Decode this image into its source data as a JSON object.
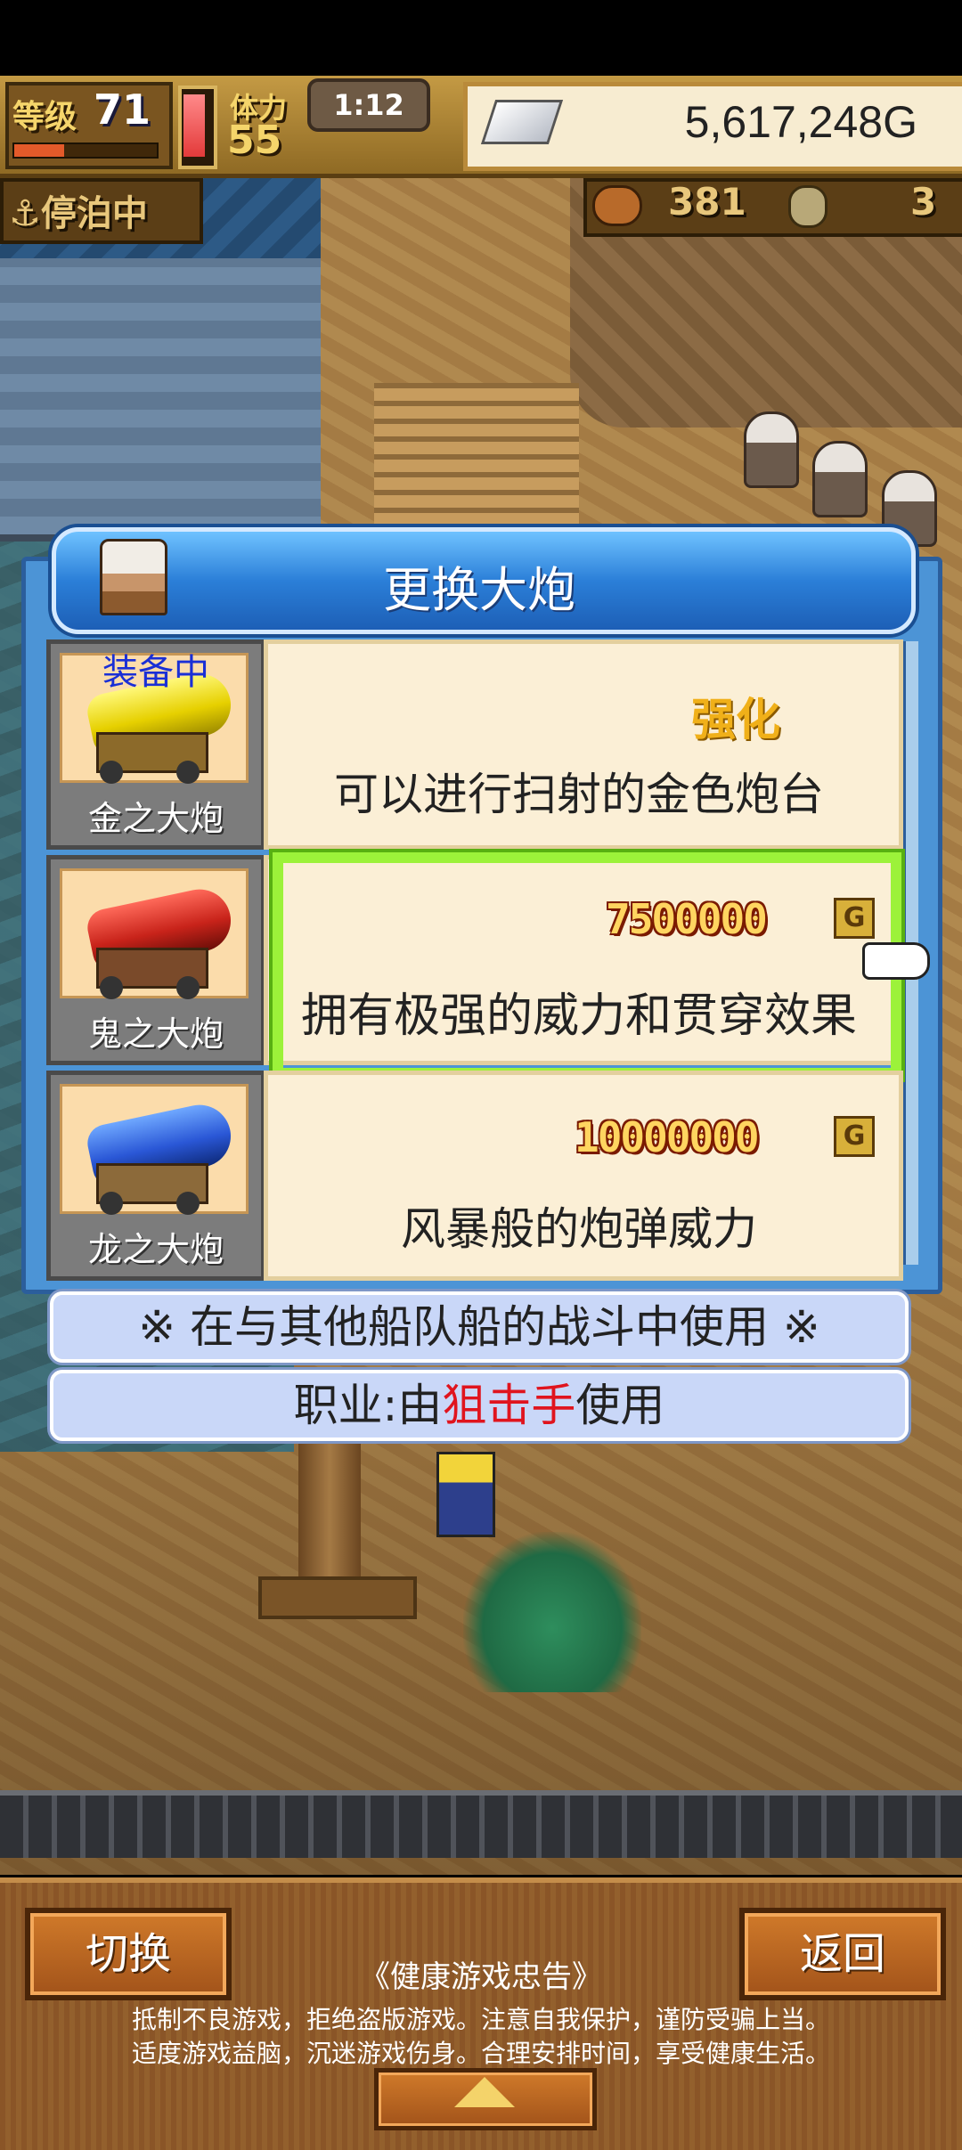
{
  "hud": {
    "level_label": "等级",
    "level_value": "71",
    "level_progress": 0.35,
    "stamina_label": "体力",
    "stamina_value": "55",
    "stamina_fill": 0.95,
    "timer": "1:12",
    "gold": "5,617,248G",
    "status": "⚓停泊中",
    "resource1_value": "381",
    "resource2_value": "3"
  },
  "dialog": {
    "title": "更换大炮",
    "items": [
      {
        "name": "金之大炮",
        "equipped_label": "装备中",
        "action_label": "强化",
        "description": "可以进行扫射的金色炮台",
        "color": "#f0e010"
      },
      {
        "name": "鬼之大炮",
        "price": "7500000",
        "currency": "G",
        "description": "拥有极强的威力和贯穿效果",
        "color": "#c8231a"
      },
      {
        "name": "龙之大炮",
        "price": "10000000",
        "currency": "G",
        "description": "风暴般的炮弹威力",
        "color": "#2a57d6"
      }
    ]
  },
  "info": {
    "usage_note": "※ 在与其他船队船的战斗中使用 ※",
    "job_prefix": "职业:由",
    "job_name": "狙击手",
    "job_suffix": "使用"
  },
  "buttons": {
    "switch_label": "切换",
    "back_label": "返回"
  },
  "health_notice": {
    "title": "《健康游戏忠告》",
    "line1": "抵制不良游戏，拒绝盗版游戏。注意自我保护，谨防受骗上当。",
    "line2": "适度游戏益脑，沉迷游戏伤身。合理安排时间，享受健康生活。"
  },
  "colors": {
    "dialog_blue": "#4c94d6",
    "selection_green": "#9cf23a",
    "equipped_text": "#1a2fd6",
    "upgrade_text": "#f0b019",
    "job_highlight": "#e0141e"
  }
}
